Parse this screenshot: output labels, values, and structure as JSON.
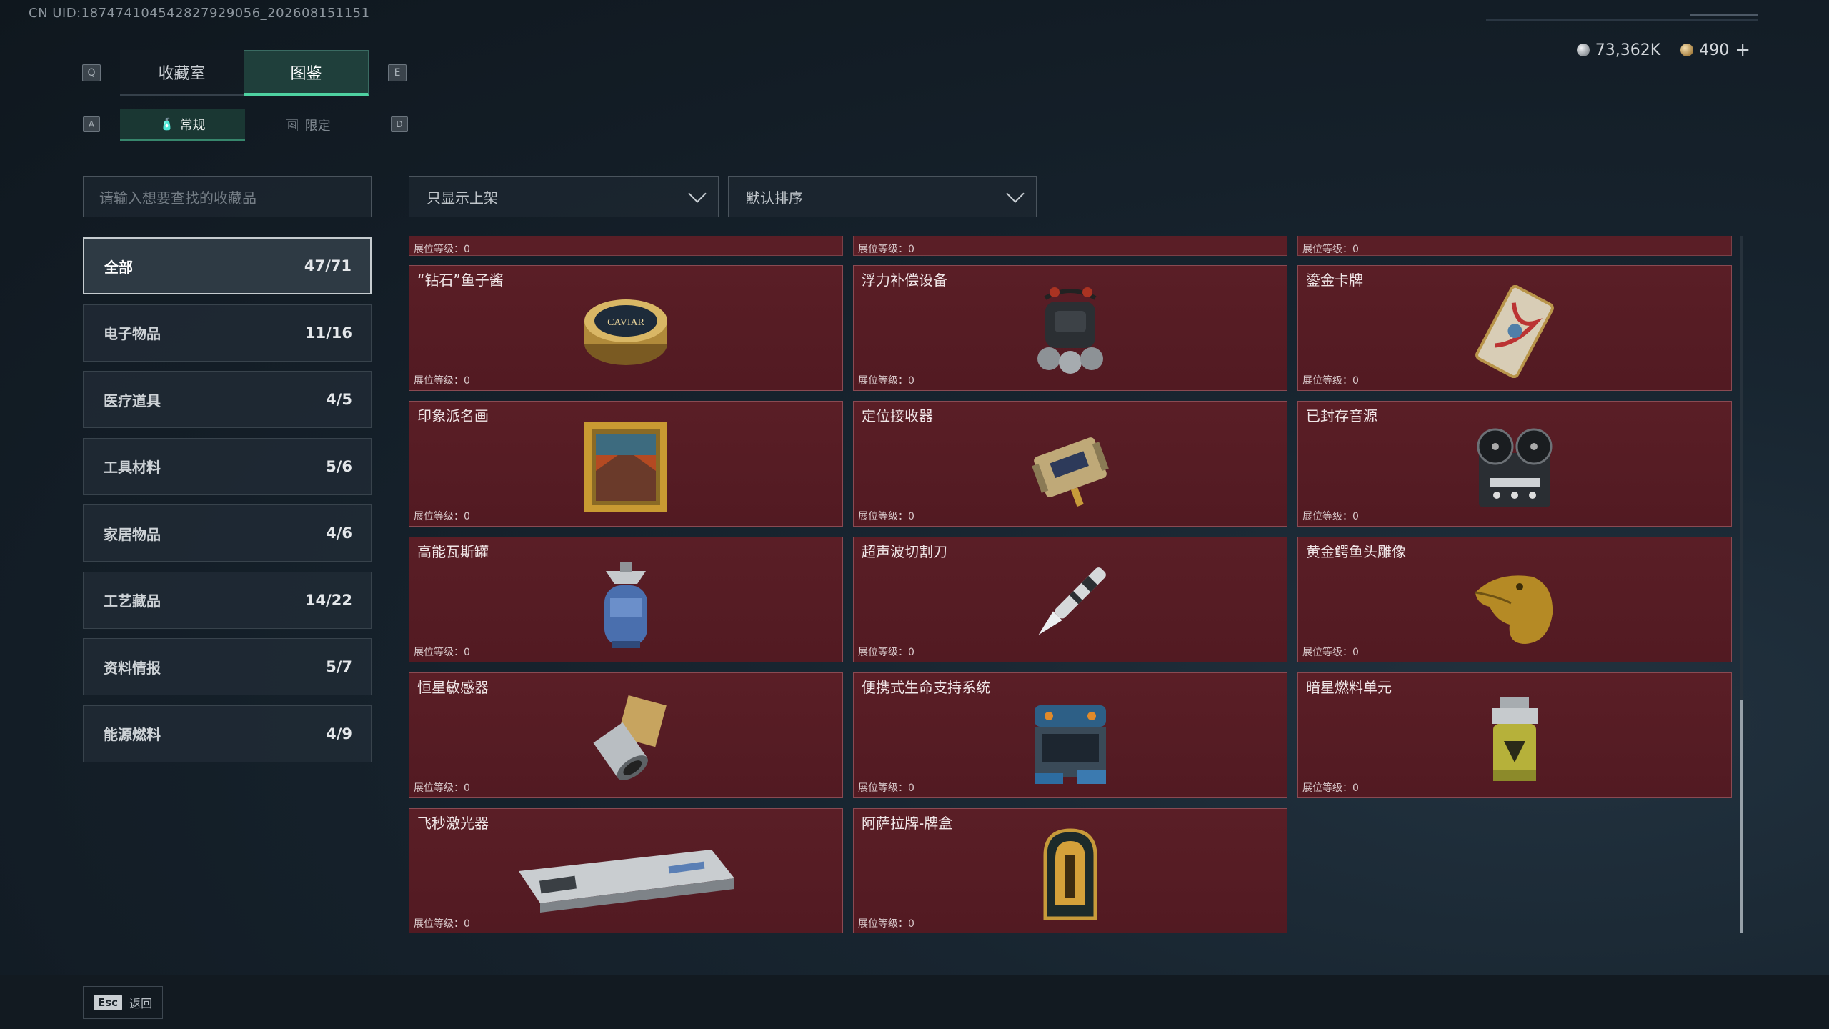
{
  "uid": "CN UID:1874741045428279290­56_202608151151",
  "header": {
    "key_left": "Q",
    "key_right": "E",
    "tabs": [
      {
        "label": "收藏室",
        "active": false
      },
      {
        "label": "图鉴",
        "active": true
      }
    ],
    "sub_key_left": "A",
    "sub_key_right": "D",
    "sub_tabs": [
      {
        "label": "常规",
        "icon": "bottle-icon",
        "active": true
      },
      {
        "label": "限定",
        "icon": "picture-icon",
        "active": false
      }
    ]
  },
  "currency": {
    "silver": "73,362K",
    "gold": "490",
    "add": "+"
  },
  "search": {
    "placeholder": "请输入想要查找的收藏品"
  },
  "filters": {
    "shelf": "只显示上架",
    "sort": "默认排序"
  },
  "categories": [
    {
      "label": "全部",
      "count": "47/71",
      "active": true
    },
    {
      "label": "电子物品",
      "count": "11/16"
    },
    {
      "label": "医疗道具",
      "count": "4/5"
    },
    {
      "label": "工具材料",
      "count": "5/6"
    },
    {
      "label": "家居物品",
      "count": "4/6"
    },
    {
      "label": "工艺藏品",
      "count": "14/22"
    },
    {
      "label": "资料情报",
      "count": "5/7"
    },
    {
      "label": "能源燃料",
      "count": "4/9"
    }
  ],
  "level_label": "展位等级：0",
  "items": [
    {
      "name": "“钻石”鱼子酱",
      "icon": "caviar-tin-icon"
    },
    {
      "name": "浮力补偿设备",
      "icon": "buoyancy-device-icon"
    },
    {
      "name": "鎏金卡牌",
      "icon": "gilded-card-icon"
    },
    {
      "name": "印象派名画",
      "icon": "painting-icon"
    },
    {
      "name": "定位接收器",
      "icon": "receiver-icon"
    },
    {
      "name": "已封存音源",
      "icon": "reel-recorder-icon"
    },
    {
      "name": "高能瓦斯罐",
      "icon": "gas-canister-icon"
    },
    {
      "name": "超声波切割刀",
      "icon": "cutter-icon"
    },
    {
      "name": "黄金鳄鱼头雕像",
      "icon": "crocodile-statue-icon"
    },
    {
      "name": "恒星敏感器",
      "icon": "star-sensor-icon"
    },
    {
      "name": "便携式生命支持系统",
      "icon": "life-support-icon"
    },
    {
      "name": "暗星燃料单元",
      "icon": "fuel-cell-icon"
    },
    {
      "name": "飞秒激光器",
      "icon": "laser-icon"
    },
    {
      "name": "阿萨拉牌-牌盒",
      "icon": "card-box-icon"
    }
  ],
  "footer": {
    "key": "Esc",
    "label": "返回"
  }
}
